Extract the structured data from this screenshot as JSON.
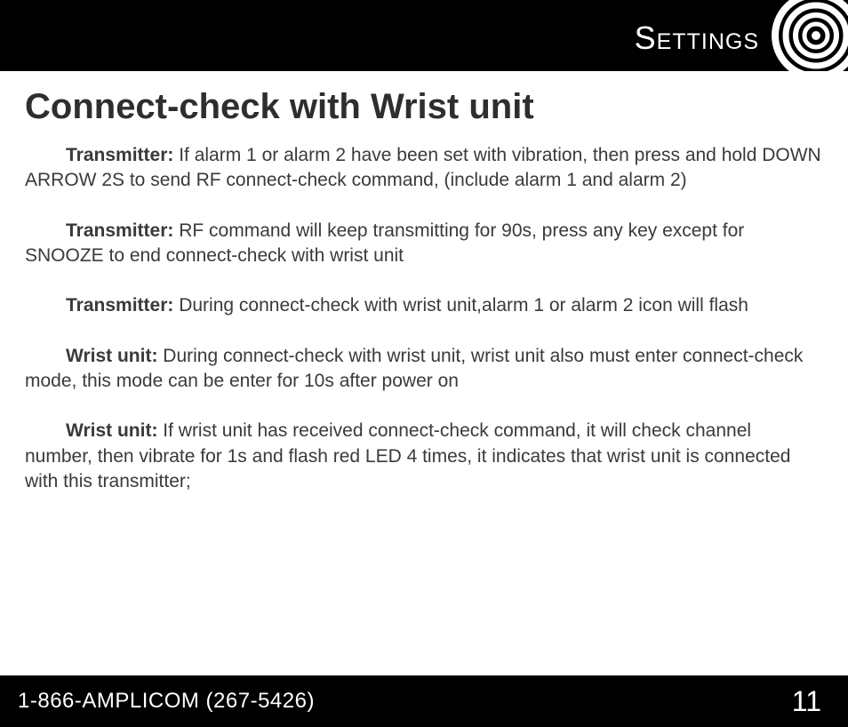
{
  "header": {
    "section": "Settings"
  },
  "title": "Connect-check with Wrist unit",
  "paragraphs": [
    {
      "label": "Transmitter:",
      "text": " If alarm 1 or alarm 2 have been set with vibration, then press and hold DOWN ARROW 2S to send RF connect-check command, (include alarm 1 and alarm 2)"
    },
    {
      "label": "Transmitter:",
      "text": " RF command will keep transmitting for 90s, press any key except for SNOOZE to end connect-check with wrist unit"
    },
    {
      "label": "Transmitter:",
      "text": " During connect-check with wrist unit,alarm 1 or alarm 2 icon will flash"
    },
    {
      "label": "Wrist unit:",
      "text": " During connect-check with wrist unit, wrist unit also must enter connect-check mode, this mode can be enter for 10s after power on"
    },
    {
      "label": "Wrist unit:",
      "text": " If wrist unit has received connect-check command, it will check channel number, then vibrate for 1s and flash red LED 4 times, it indicates that wrist unit is connected with this transmitter;"
    }
  ],
  "footer": {
    "phone": "1-866-AMPLICOM (267-5426)",
    "page": "11"
  }
}
